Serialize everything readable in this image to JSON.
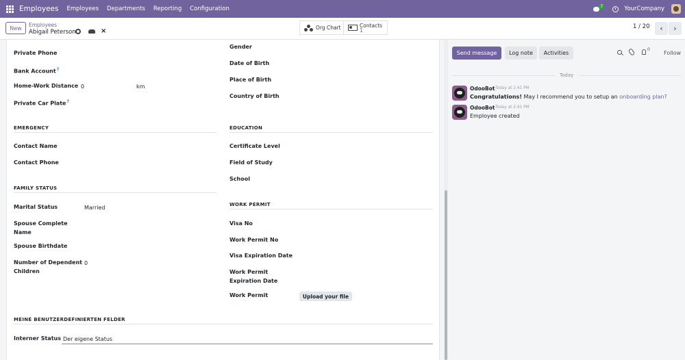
{
  "navbar": {
    "app_name": "Employees",
    "menu": [
      "Employees",
      "Departments",
      "Reporting",
      "Configuration"
    ],
    "chat_badge": "7",
    "company": "YourCompany"
  },
  "control_panel": {
    "new_label": "New",
    "breadcrumb_parent": "Employees",
    "record_name": "Abigail Peterson",
    "smart_buttons": {
      "org_chart": "Org Chart",
      "contacts_label": "Contacts",
      "contacts_count": "1"
    },
    "pager": "1 / 20"
  },
  "form": {
    "left": {
      "private_phone": "Private Phone",
      "bank_account": "Bank Account",
      "home_work_distance": "Home-Work Distance",
      "home_work_distance_value": "0",
      "home_work_distance_unit": "km",
      "private_car_plate": "Private Car Plate",
      "help_mark": "?"
    },
    "right": {
      "gender": "Gender",
      "date_of_birth": "Date of Birth",
      "place_of_birth": "Place of Birth",
      "country_of_birth": "Country of Birth"
    },
    "emergency": {
      "title": "EMERGENCY",
      "contact_name": "Contact Name",
      "contact_phone": "Contact Phone"
    },
    "education": {
      "title": "EDUCATION",
      "certificate_level": "Certificate Level",
      "field_of_study": "Field of Study",
      "school": "School"
    },
    "family_status": {
      "title": "FAMILY STATUS",
      "marital_status": "Marital Status",
      "marital_status_value": "Married",
      "spouse_complete_name_1": "Spouse Complete",
      "spouse_complete_name_2": "Name",
      "spouse_birthdate": "Spouse Birthdate",
      "dependent_children_1": "Number of Dependent",
      "dependent_children_2": "Children",
      "dependent_children_value": "0"
    },
    "work_permit": {
      "title": "WORK PERMIT",
      "visa_no": "Visa No",
      "work_permit_no": "Work Permit No",
      "visa_expiration_date": "Visa Expiration Date",
      "work_permit_expiration_1": "Work Permit",
      "work_permit_expiration_2": "Expiration Date",
      "work_permit": "Work Permit",
      "upload_label": "Upload your file"
    },
    "custom": {
      "title": "MEINE BENUTZERDEFINIERTEN FELDER",
      "interner_status": "Interner Status",
      "interner_status_value": "Der eigene Status"
    }
  },
  "chatter": {
    "send_message": "Send message",
    "log_note": "Log note",
    "activities": "Activities",
    "follower_count": "0",
    "follow": "Follow",
    "date_separator": "Today",
    "messages": [
      {
        "author": "OdooBot",
        "time": "Today at 2:41 PM",
        "body_bold": "Congratulations!",
        "body_text": " May I recommend you to setup an ",
        "body_link": "onboarding plan?"
      },
      {
        "author": "OdooBot",
        "time": "Today at 2:41 PM",
        "body_text": "Employee created"
      }
    ]
  },
  "colors": {
    "brand": "#71639e",
    "badge_green": "#28a745"
  }
}
